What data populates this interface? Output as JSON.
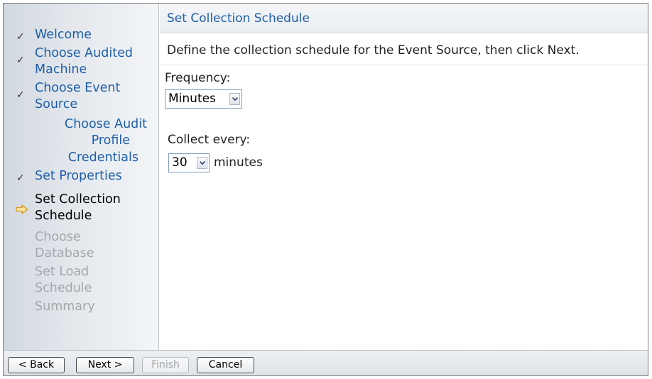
{
  "sidebar": {
    "steps": [
      {
        "label_lines": [
          "Welcome"
        ],
        "state": "done"
      },
      {
        "label_lines": [
          "Choose Audited",
          "Machine"
        ],
        "state": "done"
      },
      {
        "label_lines": [
          "Choose Event",
          "Source"
        ],
        "state": "done"
      },
      {
        "label_lines": [
          "Choose Audit",
          "Profile"
        ],
        "state": "substep"
      },
      {
        "label_lines": [
          "Credentials"
        ],
        "state": "substep"
      },
      {
        "label_lines": [
          "Set Properties"
        ],
        "state": "done"
      },
      {
        "label_lines": [
          "Set Collection",
          "Schedule"
        ],
        "state": "current"
      },
      {
        "label_lines": [
          "Choose",
          "Database"
        ],
        "state": "disabled"
      },
      {
        "label_lines": [
          "Set Load",
          "Schedule"
        ],
        "state": "disabled"
      },
      {
        "label_lines": [
          "Summary"
        ],
        "state": "disabled"
      }
    ],
    "check_glyph": "✓",
    "current_icon": "arrow-right-icon"
  },
  "header": {
    "title": "Set Collection Schedule"
  },
  "instruction": "Define the collection schedule for the Event Source, then click Next.",
  "frequency": {
    "label": "Frequency:",
    "selected": "Minutes"
  },
  "collect": {
    "label": "Collect every:",
    "selected": "30",
    "unit": "minutes"
  },
  "footer": {
    "back": "< Back",
    "next": "Next >",
    "finish": "Finish",
    "cancel": "Cancel"
  },
  "colors": {
    "link": "#1f5fa8",
    "disabled": "#a4a8ad",
    "arrow": "#f0b030"
  }
}
